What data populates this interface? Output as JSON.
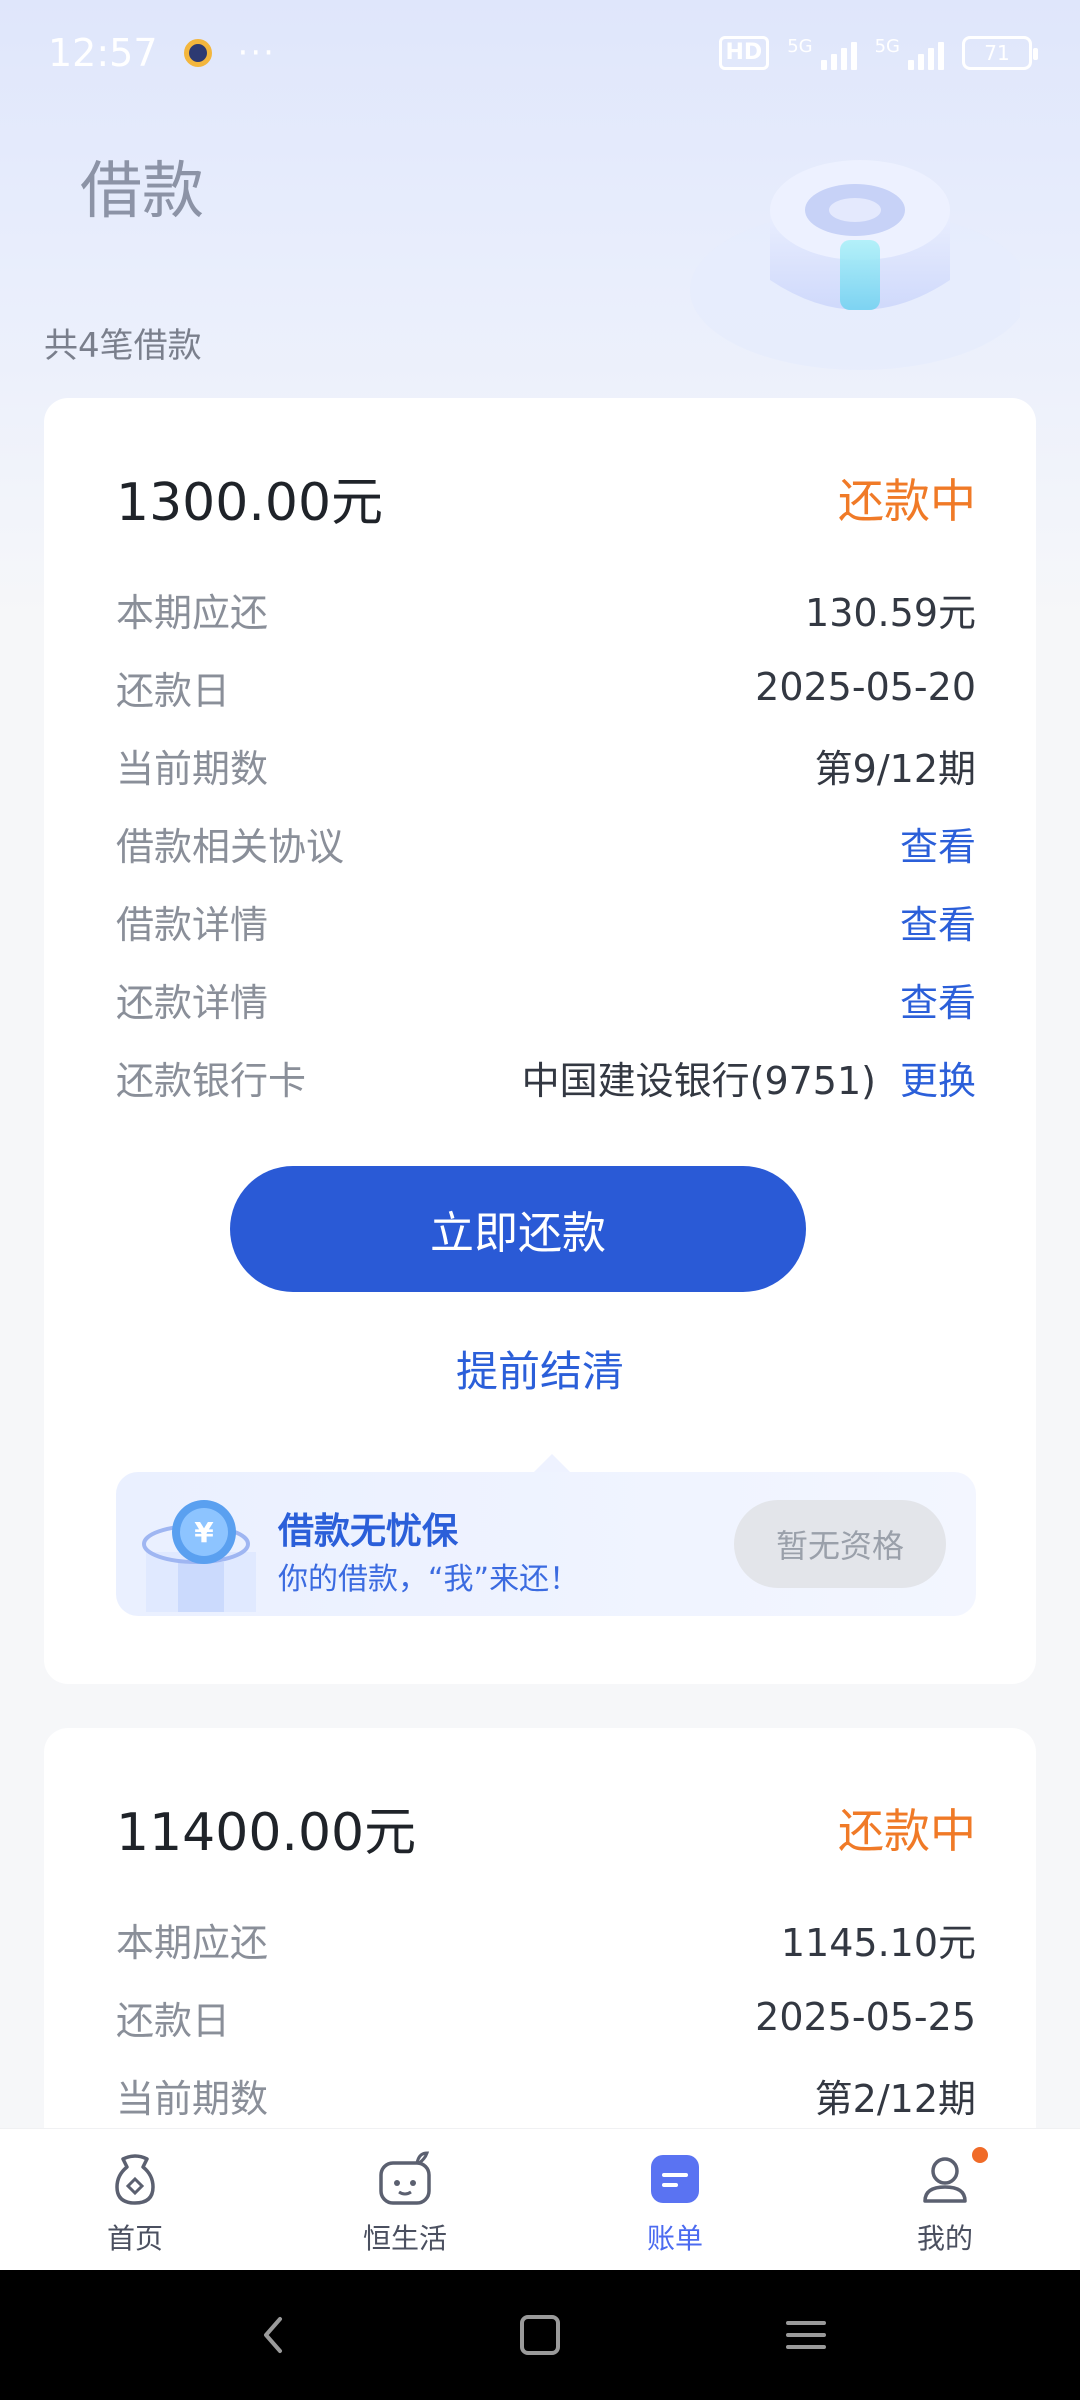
{
  "status_bar": {
    "time": "12:57",
    "more": "···",
    "hd": "HD",
    "sig1": "5G",
    "sig2": "5G",
    "battery": "71"
  },
  "header": {
    "title": "借款",
    "count": "共4笔借款"
  },
  "loans": [
    {
      "amount": "1300.00元",
      "status": "还款中",
      "rows": {
        "current_due_label": "本期应还",
        "current_due": "130.59元",
        "due_date_label": "还款日",
        "due_date": "2025-05-20",
        "term_label": "当前期数",
        "term": "第9/12期",
        "agreement_label": "借款相关协议",
        "agreement_link": "查看",
        "loan_detail_label": "借款详情",
        "loan_detail_link": "查看",
        "repay_detail_label": "还款详情",
        "repay_detail_link": "查看",
        "bank_label": "还款银行卡",
        "bank": "中国建设银行(9751)",
        "bank_link": "更换"
      },
      "pay_button": "立即还款",
      "early_settle": "提前结清",
      "promo": {
        "title": "借款无忧保",
        "subtitle": "你的借款，“我”来还！",
        "button": "暂无资格"
      }
    },
    {
      "amount": "11400.00元",
      "status": "还款中",
      "rows": {
        "current_due_label": "本期应还",
        "current_due": "1145.10元",
        "due_date_label": "还款日",
        "due_date": "2025-05-25",
        "term_label": "当前期数",
        "term": "第2/12期"
      }
    }
  ],
  "bottom_nav": {
    "home": "首页",
    "life": "恒生活",
    "bills": "账单",
    "mine": "我的"
  },
  "colors": {
    "accent": "#2a5ad6",
    "status_orange": "#f07a27",
    "link": "#2b5fd9"
  }
}
